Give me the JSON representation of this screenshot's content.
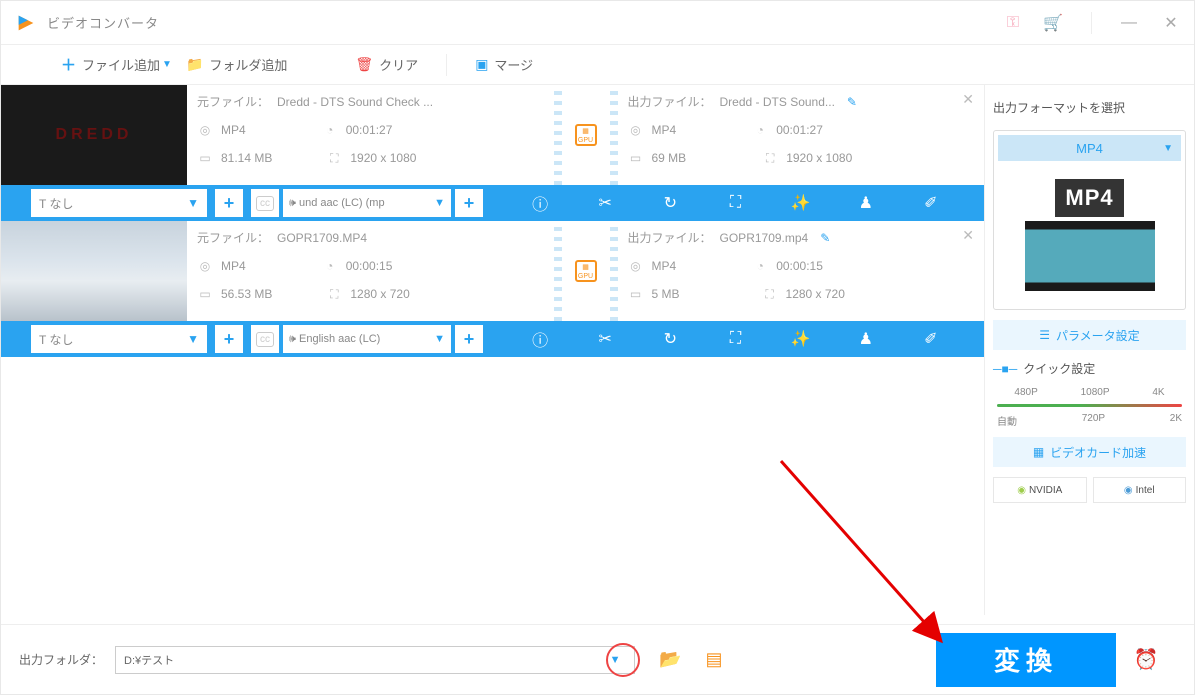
{
  "app": {
    "title": "ビデオコンバータ"
  },
  "toolbar": {
    "add_file": "ファイル追加",
    "add_folder": "フォルダ追加",
    "clear": "クリア",
    "merge": "マージ"
  },
  "items": [
    {
      "thumb_text": "DREDD",
      "src_label": "元ファイル：",
      "src_name": "Dredd - DTS Sound Check ...",
      "src_format": "MP4",
      "src_duration": "00:01:27",
      "src_size": "81.14 MB",
      "src_res": "1920 x 1080",
      "out_label": "出力ファイル：",
      "out_name": "Dredd - DTS Sound...",
      "out_format": "MP4",
      "out_duration": "00:01:27",
      "out_size": "69 MB",
      "out_res": "1920 x 1080",
      "subtitle": "なし",
      "audio": "und aac (LC) (mp"
    },
    {
      "thumb_text": "",
      "src_label": "元ファイル：",
      "src_name": "GOPR1709.MP4",
      "src_format": "MP4",
      "src_duration": "00:00:15",
      "src_size": "56.53 MB",
      "src_res": "1280 x 720",
      "out_label": "出力ファイル：",
      "out_name": "GOPR1709.mp4",
      "out_format": "MP4",
      "out_duration": "00:00:15",
      "out_size": "5 MB",
      "out_res": "1280 x 720",
      "subtitle": "なし",
      "audio": "English aac (LC)"
    }
  ],
  "side": {
    "header": "出力フォーマットを選択",
    "format": "MP4",
    "format_big": "MP4",
    "params": "パラメータ設定",
    "quick": "クイック設定",
    "res": {
      "r1": "480P",
      "r2": "1080P",
      "r3": "4K",
      "auto": "自動",
      "r4": "720P",
      "r5": "2K"
    },
    "hw": "ビデオカード加速",
    "nvidia": "NVIDIA",
    "intel": "Intel"
  },
  "footer": {
    "out_folder_label": "出力フォルダ：",
    "path": "D:¥テスト",
    "convert": "変換"
  }
}
